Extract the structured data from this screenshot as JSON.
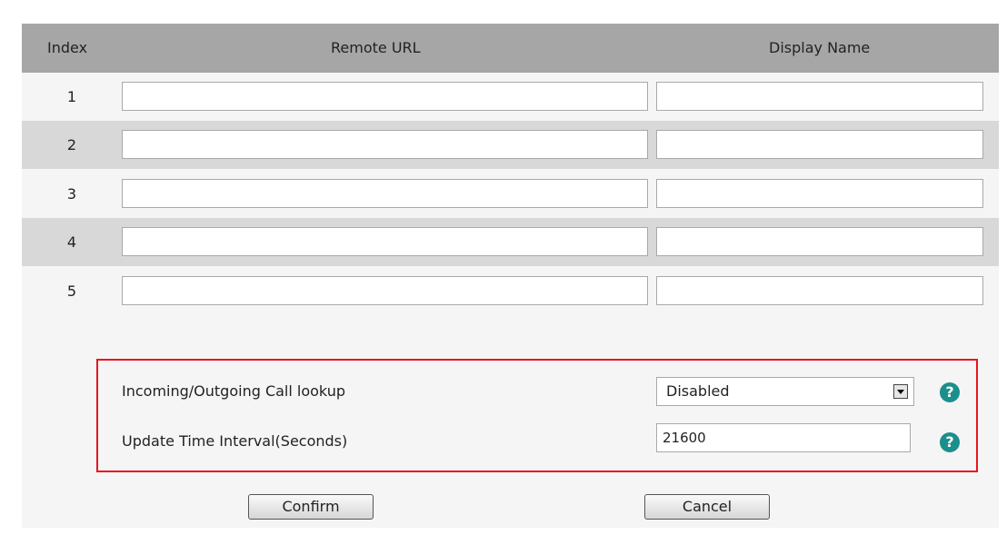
{
  "table": {
    "headers": {
      "index": "Index",
      "remote_url": "Remote URL",
      "display_name": "Display Name"
    },
    "rows": [
      {
        "index": "1",
        "remote_url": "",
        "display_name": ""
      },
      {
        "index": "2",
        "remote_url": "",
        "display_name": ""
      },
      {
        "index": "3",
        "remote_url": "",
        "display_name": ""
      },
      {
        "index": "4",
        "remote_url": "",
        "display_name": ""
      },
      {
        "index": "5",
        "remote_url": "",
        "display_name": ""
      }
    ]
  },
  "settings": {
    "call_lookup": {
      "label": "Incoming/Outgoing Call lookup",
      "value": "Disabled",
      "help_icon": "question-icon"
    },
    "update_interval": {
      "label": "Update Time Interval(Seconds)",
      "value": "21600",
      "help_icon": "question-icon"
    }
  },
  "actions": {
    "confirm": "Confirm",
    "cancel": "Cancel"
  },
  "colors": {
    "header_bg": "#a6a6a6",
    "alt_row_bg": "#d8d8d8",
    "highlight_border": "#e8141e",
    "help_icon": "#1a8f8c"
  }
}
